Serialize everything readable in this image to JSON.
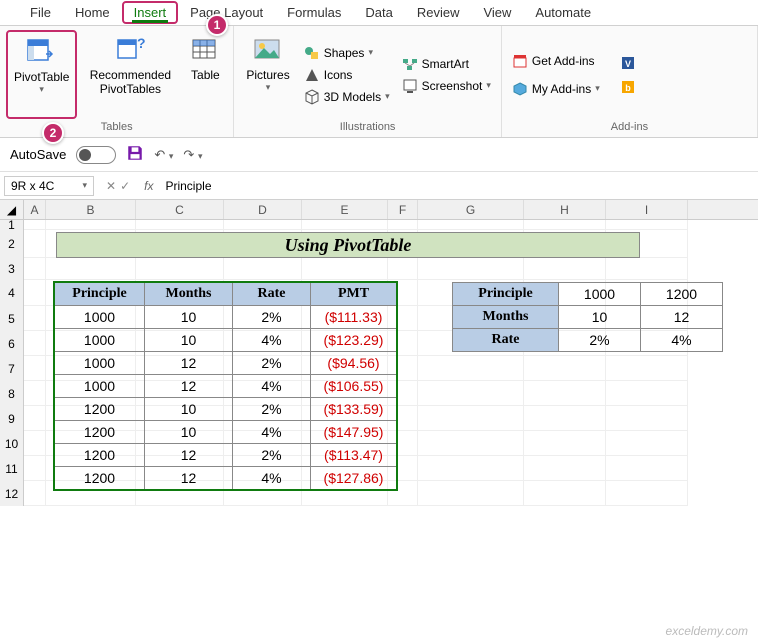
{
  "tabs": [
    "File",
    "Home",
    "Insert",
    "Page Layout",
    "Formulas",
    "Data",
    "Review",
    "View",
    "Automate"
  ],
  "active_tab": "Insert",
  "ribbon": {
    "tables": {
      "label": "Tables",
      "pivot": "PivotTable",
      "recommended": "Recommended PivotTables",
      "table": "Table"
    },
    "illustrations": {
      "label": "Illustrations",
      "pictures": "Pictures",
      "shapes": "Shapes",
      "icons": "Icons",
      "models3d": "3D Models",
      "smartart": "SmartArt",
      "screenshot": "Screenshot"
    },
    "addins": {
      "label": "Add-ins",
      "get": "Get Add-ins",
      "my": "My Add-ins"
    }
  },
  "callouts": {
    "one": "1",
    "two": "2"
  },
  "qat": {
    "autosave": "AutoSave"
  },
  "namebox": "9R x 4C",
  "formula": "Principle",
  "fx_label": "fx",
  "title": "Using PivotTable",
  "colheads": [
    "A",
    "B",
    "C",
    "D",
    "E",
    "F",
    "G",
    "H",
    "I"
  ],
  "rownums": [
    "1",
    "2",
    "3",
    "4",
    "5",
    "6",
    "7",
    "8",
    "9",
    "10",
    "11",
    "12"
  ],
  "main_headers": [
    "Principle",
    "Months",
    "Rate",
    "PMT"
  ],
  "main_rows": [
    [
      "1000",
      "10",
      "2%",
      "($111.33)"
    ],
    [
      "1000",
      "10",
      "4%",
      "($123.29)"
    ],
    [
      "1000",
      "12",
      "2%",
      "($94.56)"
    ],
    [
      "1000",
      "12",
      "4%",
      "($106.55)"
    ],
    [
      "1200",
      "10",
      "2%",
      "($133.59)"
    ],
    [
      "1200",
      "10",
      "4%",
      "($147.95)"
    ],
    [
      "1200",
      "12",
      "2%",
      "($113.47)"
    ],
    [
      "1200",
      "12",
      "4%",
      "($127.86)"
    ]
  ],
  "side_headers": [
    "Principle",
    "Months",
    "Rate"
  ],
  "side_rows": [
    [
      "1000",
      "1200"
    ],
    [
      "10",
      "12"
    ],
    [
      "2%",
      "4%"
    ]
  ],
  "watermark": "exceldemy.com",
  "chart_data": {
    "type": "table",
    "title": "Using PivotTable",
    "columns": [
      "Principle",
      "Months",
      "Rate",
      "PMT"
    ],
    "rows": [
      [
        1000,
        10,
        0.02,
        -111.33
      ],
      [
        1000,
        10,
        0.04,
        -123.29
      ],
      [
        1000,
        12,
        0.02,
        -94.56
      ],
      [
        1000,
        12,
        0.04,
        -106.55
      ],
      [
        1200,
        10,
        0.02,
        -133.59
      ],
      [
        1200,
        10,
        0.04,
        -147.95
      ],
      [
        1200,
        12,
        0.02,
        -113.47
      ],
      [
        1200,
        12,
        0.04,
        -127.86
      ]
    ]
  }
}
